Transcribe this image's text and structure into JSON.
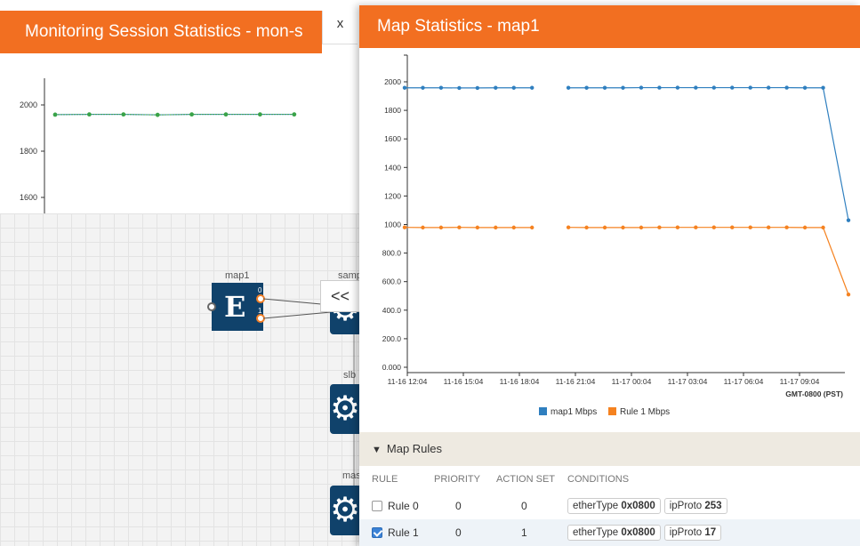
{
  "left": {
    "title": "Monitoring Session Statistics - mon-s",
    "close_label": "x",
    "chart": {
      "yticks": [
        "2000",
        "1800",
        "1600"
      ],
      "values": [
        1958,
        1959,
        1959,
        1957,
        1959,
        1959,
        1959,
        1959
      ]
    },
    "nodes": {
      "map_label": "map1",
      "map_glyph": "E",
      "port0": "0",
      "port1": "1",
      "samp_label": "samp",
      "slb_label": "slb",
      "mas_label": "mas"
    },
    "collapse_label": "<<"
  },
  "right": {
    "title": "Map Statistics - map1"
  },
  "chart_data": {
    "type": "line",
    "x": [
      "11-16 12:04",
      "11-16 15:04",
      "11-16 18:04",
      "11-16 21:04",
      "11-17 00:04",
      "11-17 03:04",
      "11-17 06:04",
      "11-17 09:04"
    ],
    "xlabel": "GMT-0800 (PST)",
    "ylim": [
      0,
      2000
    ],
    "yticks": [
      "0.000",
      "200.0",
      "400.0",
      "600.0",
      "800.0",
      "1000",
      "1200",
      "1400",
      "1600",
      "1800",
      "2000"
    ],
    "series": [
      {
        "name": "map1 Mbps",
        "color": "#2f7fbf",
        "values": [
          1958,
          1958,
          1958,
          1957,
          1957,
          1958,
          1958,
          1958,
          null,
          1958,
          1958,
          1958,
          1958,
          1959,
          1959,
          1959,
          1959,
          1959,
          1959,
          1959,
          1959,
          1959,
          1958,
          1958,
          1030
        ]
      },
      {
        "name": "Rule 1 Mbps",
        "color": "#f58220",
        "values": [
          980,
          979,
          979,
          980,
          979,
          979,
          979,
          979,
          null,
          980,
          979,
          979,
          979,
          979,
          980,
          980,
          980,
          980,
          980,
          980,
          980,
          980,
          979,
          979,
          510
        ]
      }
    ]
  },
  "rules": {
    "header": "Map Rules",
    "columns": [
      "RULE",
      "PRIORITY",
      "ACTION SET",
      "CONDITIONS"
    ],
    "rows": [
      {
        "rule": "Rule 0",
        "checked": false,
        "priority": "0",
        "action_set": "0",
        "cond1_key": "etherType",
        "cond1_val": "0x0800",
        "cond2_key": "ipProto",
        "cond2_val": "253"
      },
      {
        "rule": "Rule 1",
        "checked": true,
        "priority": "0",
        "action_set": "1",
        "cond1_key": "etherType",
        "cond1_val": "0x0800",
        "cond2_key": "ipProto",
        "cond2_val": "17"
      }
    ]
  }
}
